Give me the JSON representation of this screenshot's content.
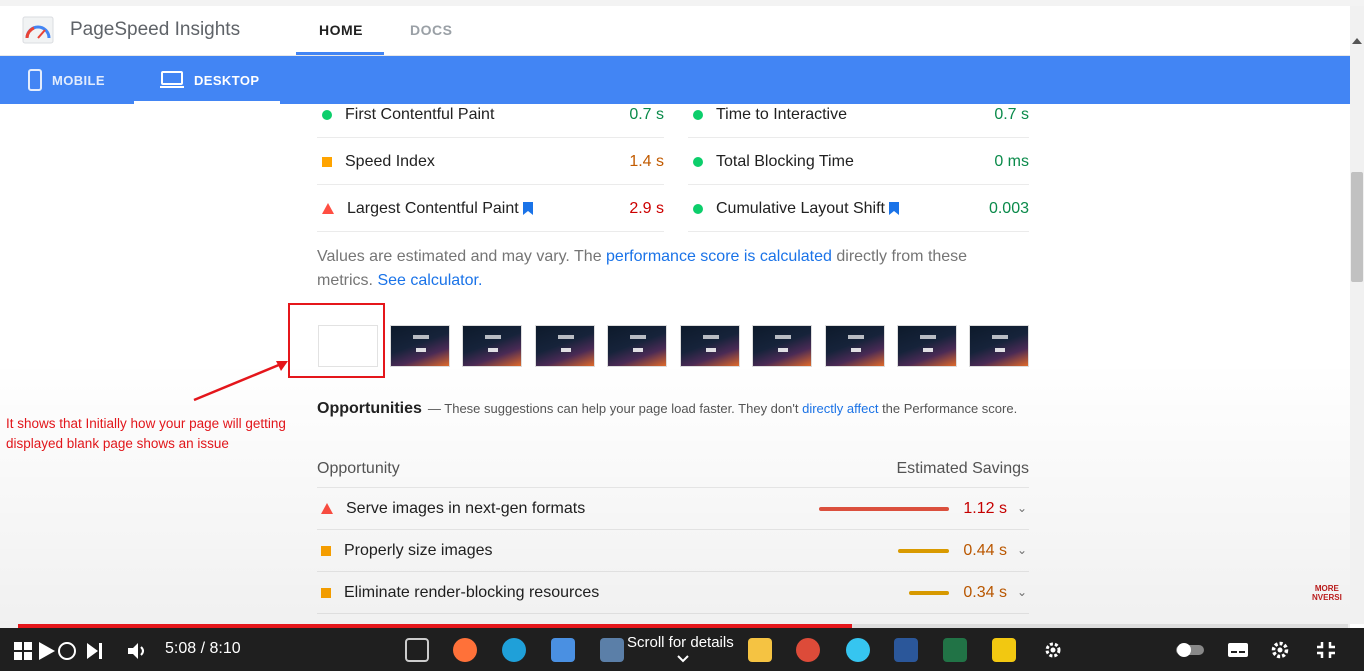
{
  "app": {
    "title": "PageSpeed Insights",
    "nav": {
      "home": "HOME",
      "docs": "DOCS"
    }
  },
  "device_tabs": {
    "mobile": "MOBILE",
    "desktop": "DESKTOP"
  },
  "metrics": {
    "left": [
      {
        "label": "First Contentful Paint",
        "value": "0.7 s",
        "status": "green"
      },
      {
        "label": "Speed Index",
        "value": "1.4 s",
        "status": "orange"
      },
      {
        "label": "Largest Contentful Paint",
        "value": "2.9 s",
        "status": "red"
      }
    ],
    "right": [
      {
        "label": "Time to Interactive",
        "value": "0.7 s",
        "status": "green"
      },
      {
        "label": "Total Blocking Time",
        "value": "0 ms",
        "status": "green"
      },
      {
        "label": "Cumulative Layout Shift",
        "value": "0.003",
        "status": "green"
      }
    ]
  },
  "note": {
    "text_1": "Values are estimated and may vary. The ",
    "link_1": "performance score is calculated",
    "text_2": " directly from these metrics. ",
    "link_2": "See calculator."
  },
  "annotation": "It shows that Initially how your page will getting displayed blank page shows an issue",
  "opportunities": {
    "title": "Opportunities",
    "desc_1": "— These suggestions can help your page load faster. They don't ",
    "desc_link": "directly affect",
    "desc_2": " the Performance score.",
    "col_opportunity": "Opportunity",
    "col_savings": "Estimated Savings",
    "rows": [
      {
        "label": "Serve images in next-gen formats",
        "savings": "1.12 s",
        "status": "red"
      },
      {
        "label": "Properly size images",
        "savings": "0.44 s",
        "status": "orange"
      },
      {
        "label": "Eliminate render-blocking resources",
        "savings": "0.34 s",
        "status": "orange"
      }
    ]
  },
  "player": {
    "time": "5:08 / 8:10",
    "hint": "Scroll for details",
    "watermark_1": "MORE",
    "watermark_2": "NVERSI"
  },
  "colors": {
    "brand_blue": "#4285f4",
    "pass_green": "#0cce6b",
    "average_orange": "#ffa400",
    "fail_red": "#ff4e42",
    "annotation_red": "#e5161b"
  }
}
